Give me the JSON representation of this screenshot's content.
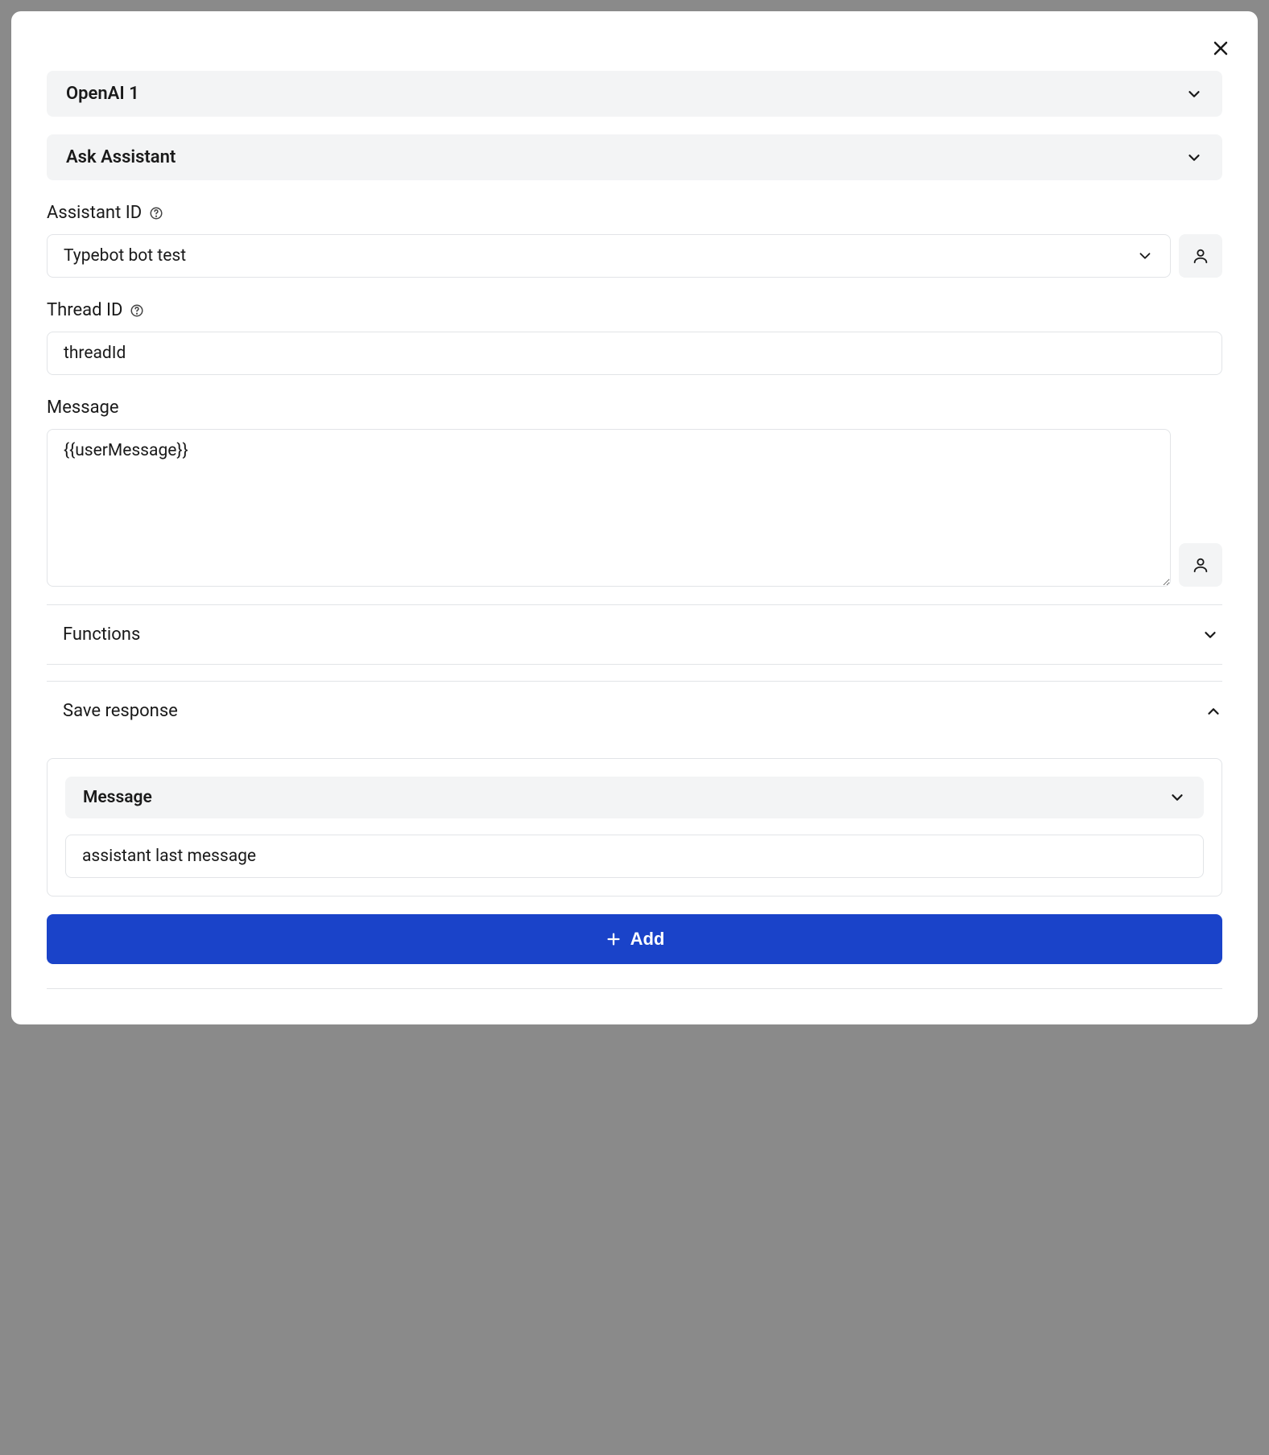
{
  "connection": {
    "label": "OpenAI 1"
  },
  "action": {
    "label": "Ask Assistant"
  },
  "assistantId": {
    "label": "Assistant ID",
    "value": "Typebot bot test"
  },
  "threadId": {
    "label": "Thread ID",
    "value": "threadId"
  },
  "message": {
    "label": "Message",
    "value": "{{userMessage}}"
  },
  "functions": {
    "label": "Functions"
  },
  "saveResponse": {
    "label": "Save response",
    "mapping": {
      "type": "Message",
      "variable": "assistant last message"
    },
    "addLabel": "Add"
  }
}
